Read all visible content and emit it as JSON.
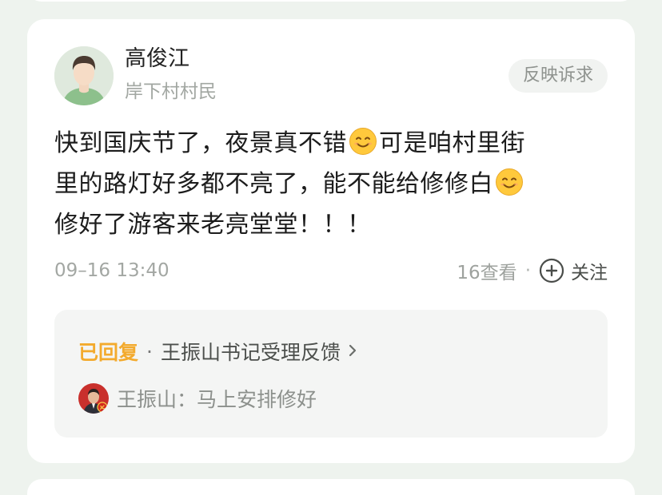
{
  "post": {
    "author": {
      "name": "高俊江",
      "role": "岸下村村民",
      "avatar_icon": "person-avatar-icon"
    },
    "tag": "反映诉求",
    "content_lines": {
      "l1a": "快到国庆节了，夜景真不错",
      "l1b": "可是咱村里街",
      "l2a": "里的路灯好多都不亮了，能不能给修修白",
      "l3": "修好了游客来老亮堂堂！！！"
    },
    "emoji_icon": "smiling-face-emoji-icon",
    "time": "09–16 13:40",
    "views": "16查看",
    "meta_separator": "·",
    "follow_label": "关注"
  },
  "reply": {
    "status": "已回复",
    "separator": "·",
    "handler_text": "王振山书记受理反馈",
    "chevron_icon": "chevron-right-icon",
    "responder_icon": "official-avatar-icon",
    "reply_text": "王振山：马上安排修好"
  },
  "colors": {
    "background": "#eef3ee",
    "card": "#ffffff",
    "status_orange": "#f3aa2d",
    "emoji_yellow": "#ffc93c",
    "reply_box": "#f4f5f4"
  }
}
